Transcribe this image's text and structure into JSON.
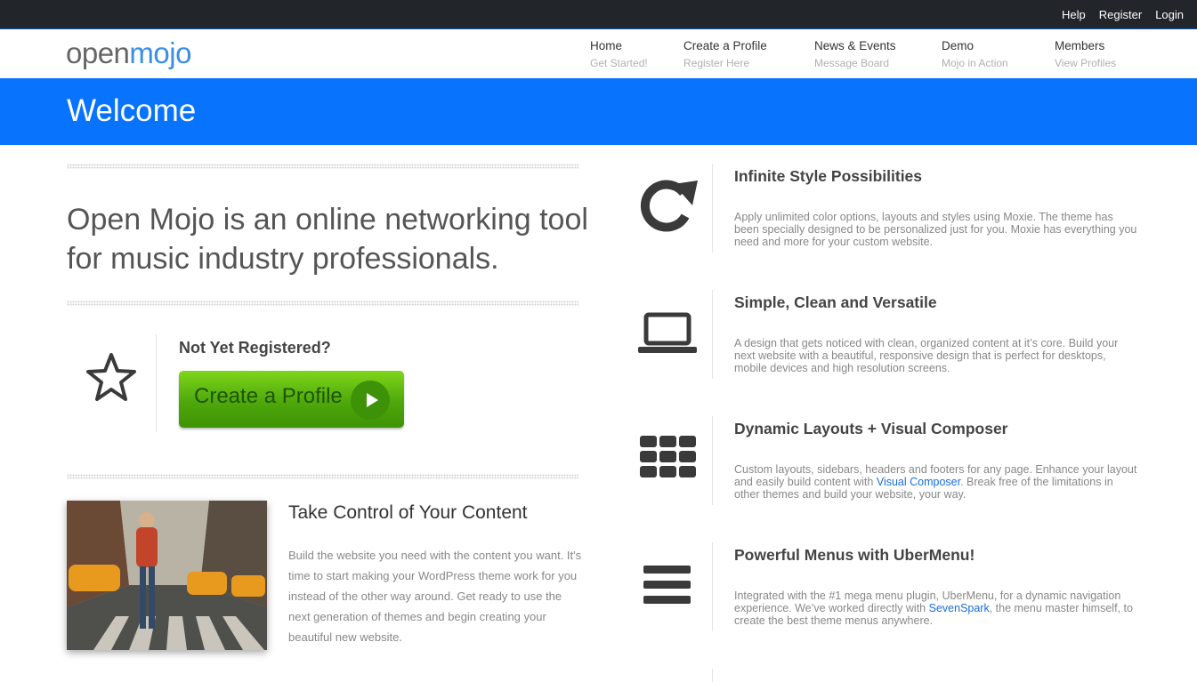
{
  "topbar": {
    "links": [
      "Help",
      "Register",
      "Login"
    ]
  },
  "logo": {
    "part1": "open",
    "part2": "mojo"
  },
  "nav": [
    {
      "title": "Home",
      "sub": "Get Started!"
    },
    {
      "title": "Create a Profile",
      "sub": "Register Here"
    },
    {
      "title": "News & Events",
      "sub": "Message Board"
    },
    {
      "title": "Demo",
      "sub": "Mojo in Action"
    },
    {
      "title": "Members",
      "sub": "View Profiles"
    }
  ],
  "banner": {
    "title": "Welcome"
  },
  "intro": {
    "text": "Open Mojo is an online networking tool for music industry professionals."
  },
  "register": {
    "title": "Not Yet Registered?",
    "button": "Create a Profile"
  },
  "content": {
    "title": "Take Control of Your Content",
    "body": "Build the website you need with the content you want. It's time to start making your WordPress theme work for you instead of the other way around. Get ready to use the next generation of themes and begin creating your beautiful new website."
  },
  "features": [
    {
      "icon": "refresh-icon",
      "title": "Infinite Style Possibilities",
      "body": "Apply unlimited color options, layouts and styles using Moxie. The theme has been specially designed to be personalized just for you. Moxie has everything you need and more for your custom website."
    },
    {
      "icon": "laptop-icon",
      "title": "Simple, Clean and Versatile",
      "body": "A design that gets noticed with clean, organized content at it’s core. Build your next website with a beautiful, responsive design that is perfect for desktops, mobile devices and high resolution screens."
    },
    {
      "icon": "grid-icon",
      "title": "Dynamic Layouts + Visual Composer",
      "body_before": "Custom layouts, sidebars, headers and footers for any page. Enhance your layout and easily build content with ",
      "link": "Visual Composer",
      "body_after": ". Break free of the limitations in other themes and build your website, your way."
    },
    {
      "icon": "menu-icon",
      "title": "Powerful Menus with UberMenu!",
      "body_before": "Integrated with the #1 mega menu plugin, UberMenu, for a dynamic navigation experience. We’ve worked directly with ",
      "link": "SevenSpark",
      "body_after": ", the menu master himself, to create the best theme menus anywhere."
    }
  ]
}
